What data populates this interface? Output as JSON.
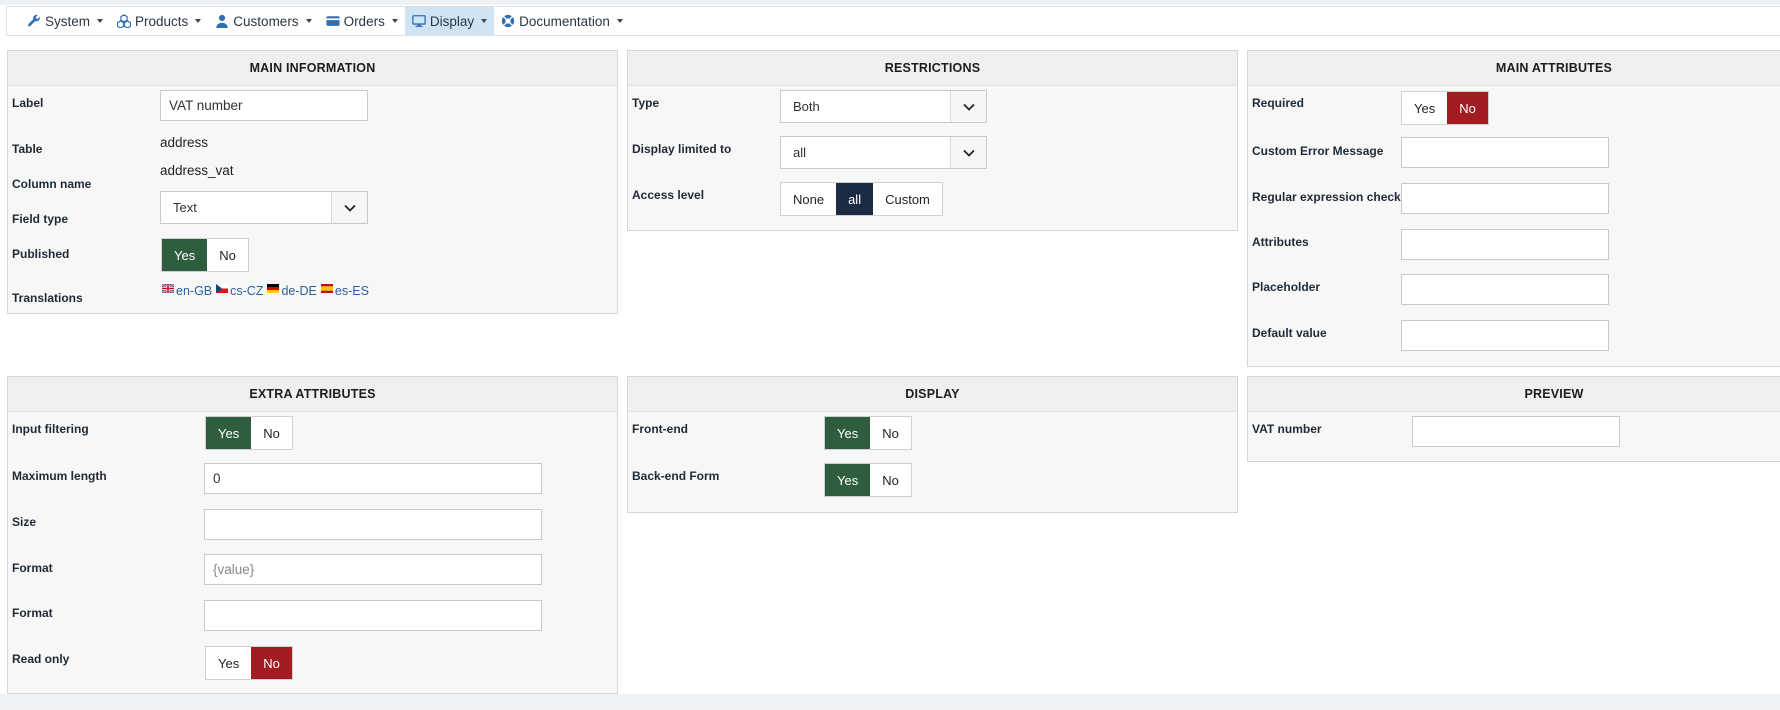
{
  "menu": [
    {
      "label": "System",
      "icon": "wrench-icon"
    },
    {
      "label": "Products",
      "icon": "cubes-icon"
    },
    {
      "label": "Customers",
      "icon": "user-icon"
    },
    {
      "label": "Orders",
      "icon": "credit-card-icon"
    },
    {
      "label": "Display",
      "icon": "monitor-icon",
      "active": true
    },
    {
      "label": "Documentation",
      "icon": "lifebuoy-icon"
    }
  ],
  "main_information": {
    "title": "MAIN INFORMATION",
    "label_label": "Label",
    "label_value": "VAT number",
    "table_label": "Table",
    "table_value": "address",
    "column_label": "Column name",
    "column_value": "address_vat",
    "fieldtype_label": "Field type",
    "fieldtype_value": "Text",
    "published_label": "Published",
    "published_yes": "Yes",
    "published_no": "No",
    "translations_label": "Translations",
    "translations": [
      "en-GB",
      "cs-CZ",
      "de-DE",
      "es-ES"
    ]
  },
  "restrictions": {
    "title": "RESTRICTIONS",
    "type_label": "Type",
    "type_value": "Both",
    "display_label": "Display limited to",
    "display_value": "all",
    "access_label": "Access level",
    "access_options": [
      "None",
      "all",
      "Custom"
    ]
  },
  "main_attributes": {
    "title": "MAIN ATTRIBUTES",
    "required_label": "Required",
    "required_yes": "Yes",
    "required_no": "No",
    "custom_error_label": "Custom Error Message",
    "regex_label": "Regular expression check",
    "attributes_label": "Attributes",
    "placeholder_label": "Placeholder",
    "default_label": "Default value"
  },
  "extra_attributes": {
    "title": "EXTRA ATTRIBUTES",
    "filtering_label": "Input filtering",
    "filtering_yes": "Yes",
    "filtering_no": "No",
    "maxlen_label": "Maximum length",
    "maxlen_value": "0",
    "size_label": "Size",
    "format1_label": "Format",
    "format1_placeholder": "{value}",
    "format2_label": "Format",
    "readonly_label": "Read only",
    "readonly_yes": "Yes",
    "readonly_no": "No"
  },
  "display": {
    "title": "DISPLAY",
    "frontend_label": "Front-end",
    "frontend_yes": "Yes",
    "frontend_no": "No",
    "backend_label": "Back-end Form",
    "backend_yes": "Yes",
    "backend_no": "No"
  },
  "preview": {
    "title": "PREVIEW",
    "vat_label": "VAT number"
  },
  "colors": {
    "accent_green": "#2f5e3e",
    "accent_red": "#a11d21",
    "accent_navy": "#1b2b44",
    "active_menu": "#cfe3f3",
    "link_blue": "#2b5f9e"
  }
}
